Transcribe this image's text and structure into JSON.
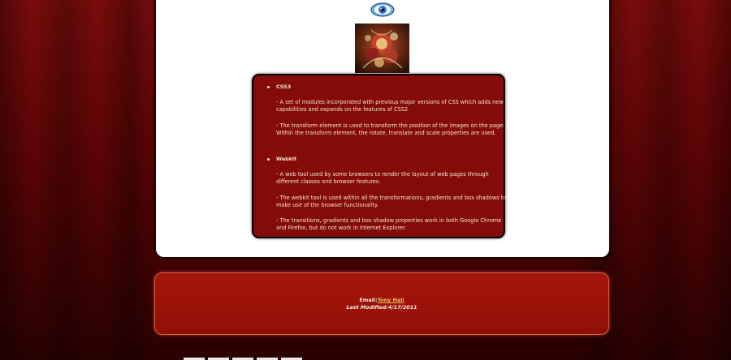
{
  "logo": {
    "icon": "eye-icon"
  },
  "thumbnail": {
    "icon": "ornate-artwork-image"
  },
  "info": {
    "topics": [
      {
        "title": "CSS3",
        "paragraphs": [
          "- A set of modules incorporated with previous major versions of CSS which adds new capabilities and expands on the features of CSS2",
          "- The transform element is used to transform the position of the images on the page. Within the transform element, the rotate, translate and scale properties are used."
        ]
      },
      {
        "title": "Webkit",
        "paragraphs": [
          "- A web tool used by some browsers to render the layout of web pages through different classes and browser features.",
          "- The webkit tool is used within all the transformations, gradients and box shadows to make use of the browser functionality.",
          "- The transitions, gradients and box shadow properties work in both Google Chrome and Firefox, but do not work in Internet Explorer."
        ]
      }
    ]
  },
  "footer": {
    "email_label": "Email:",
    "email_name": "Tony Hall",
    "modified": "Last Modified:4/17/2011"
  },
  "colors": {
    "background": "#5a0404",
    "info_box": "#840b07",
    "footer_box": "#9b1209",
    "link": "#f0c060"
  }
}
